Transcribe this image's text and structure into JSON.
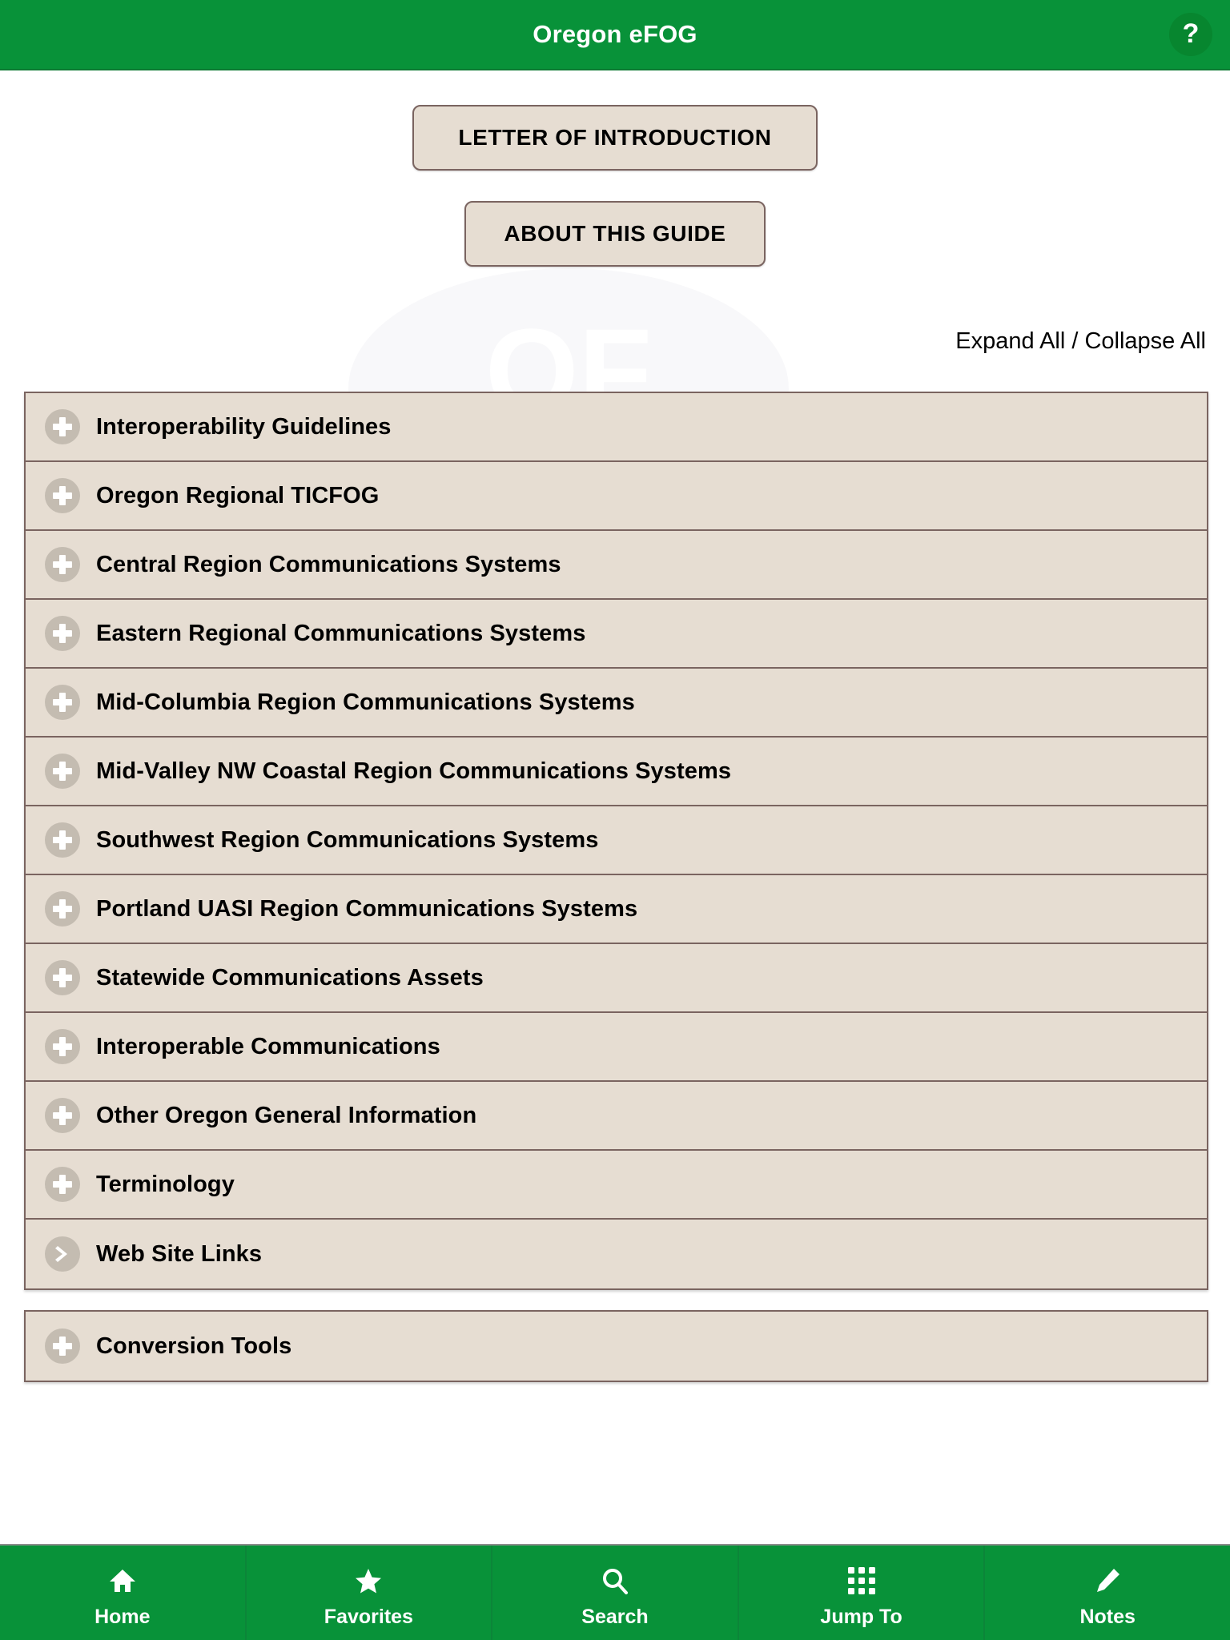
{
  "header": {
    "title": "Oregon eFOG",
    "help_label": "?",
    "bg_color": "#089239"
  },
  "top_buttons": [
    {
      "label": "LETTER OF INTRODUCTION",
      "name": "letter-of-introduction-button"
    },
    {
      "label": "ABOUT THIS GUIDE",
      "name": "about-this-guide-button"
    }
  ],
  "expand_collapse": {
    "label": "Expand All / Collapse All"
  },
  "accordion": {
    "bg_color": "#e6ddd2",
    "border_color": "#7a6460",
    "icon_color": "#c4bcb1",
    "main_items": [
      {
        "label": "Interoperability Guidelines",
        "icon": "plus-icon"
      },
      {
        "label": "Oregon Regional TICFOG",
        "icon": "plus-icon"
      },
      {
        "label": "Central Region Communications Systems",
        "icon": "plus-icon"
      },
      {
        "label": "Eastern Regional Communications Systems",
        "icon": "plus-icon"
      },
      {
        "label": "Mid-Columbia Region Communications Systems",
        "icon": "plus-icon"
      },
      {
        "label": "Mid-Valley NW Coastal Region Communications Systems",
        "icon": "plus-icon"
      },
      {
        "label": "Southwest Region Communications Systems",
        "icon": "plus-icon"
      },
      {
        "label": "Portland UASI Region Communications Systems",
        "icon": "plus-icon"
      },
      {
        "label": "Statewide Communications Assets",
        "icon": "plus-icon"
      },
      {
        "label": "Interoperable Communications",
        "icon": "plus-icon"
      },
      {
        "label": "Other Oregon General Information",
        "icon": "plus-icon"
      },
      {
        "label": "Terminology",
        "icon": "plus-icon"
      },
      {
        "label": "Web Site Links",
        "icon": "chevron-right-icon"
      }
    ],
    "tools_items": [
      {
        "label": "Conversion Tools",
        "icon": "plus-icon"
      }
    ]
  },
  "tabbar": {
    "bg_color": "#089239",
    "items": [
      {
        "label": "Home",
        "icon": "home-icon"
      },
      {
        "label": "Favorites",
        "icon": "star-icon"
      },
      {
        "label": "Search",
        "icon": "search-icon"
      },
      {
        "label": "Jump To",
        "icon": "grid-icon"
      },
      {
        "label": "Notes",
        "icon": "pencil-icon"
      }
    ]
  }
}
